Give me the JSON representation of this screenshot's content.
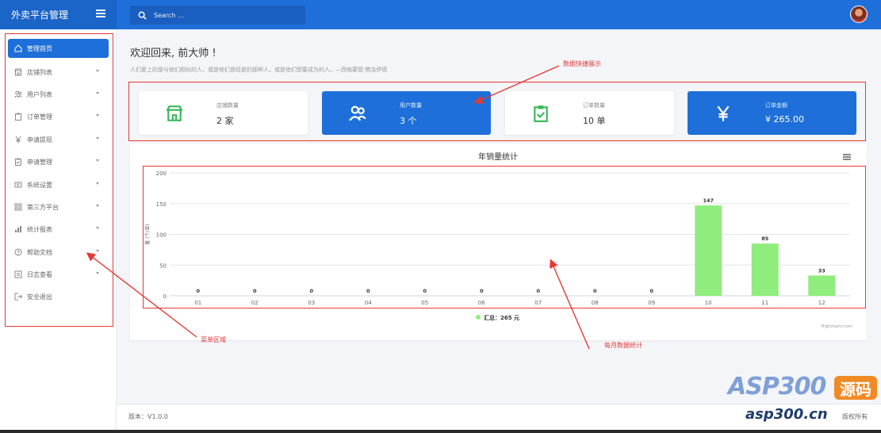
{
  "app": {
    "title": "外卖平台管理"
  },
  "search": {
    "placeholder": "Search ..."
  },
  "sidebar": {
    "items": [
      {
        "label": "管理首页",
        "icon": "home-icon",
        "active": true,
        "has_children": false
      },
      {
        "label": "店铺列表",
        "icon": "store-icon",
        "active": false,
        "has_children": true
      },
      {
        "label": "用户列表",
        "icon": "users-icon",
        "active": false,
        "has_children": true
      },
      {
        "label": "订单管理",
        "icon": "clipboard-icon",
        "active": false,
        "has_children": true
      },
      {
        "label": "申请提现",
        "icon": "yen-icon",
        "active": false,
        "has_children": true
      },
      {
        "label": "申请管理",
        "icon": "clipboard-check-icon",
        "active": false,
        "has_children": true
      },
      {
        "label": "系统设置",
        "icon": "settings-icon",
        "active": false,
        "has_children": true
      },
      {
        "label": "第三方平台",
        "icon": "grid-icon",
        "active": false,
        "has_children": true
      },
      {
        "label": "统计报表",
        "icon": "bar-chart-icon",
        "active": false,
        "has_children": true
      },
      {
        "label": "帮助文档",
        "icon": "help-icon",
        "active": false,
        "has_children": true
      },
      {
        "label": "日志查看",
        "icon": "log-icon",
        "active": false,
        "has_children": true
      },
      {
        "label": "安全退出",
        "icon": "logout-icon",
        "active": false,
        "has_children": false
      }
    ]
  },
  "main": {
    "welcome": "欢迎回来, 前大帅 !",
    "quote": "人们爱上的是与他们相似的人，或是他们曾经是的那种人，或是他们想要成为的人。—西格蒙德·佛洛伊德"
  },
  "cards": [
    {
      "label": "店铺数量",
      "value": "2 家",
      "icon": "store-icon",
      "style": "white"
    },
    {
      "label": "用户数量",
      "value": "3 个",
      "icon": "users-icon",
      "style": "blue"
    },
    {
      "label": "订单数量",
      "value": "10 单",
      "icon": "clipboard-check-icon",
      "style": "white"
    },
    {
      "label": "订单金额",
      "value": "¥ 265.00",
      "icon": "yen-icon",
      "style": "blue"
    }
  ],
  "chart_data": {
    "type": "bar",
    "title": "年销量统计",
    "ylabel": "量 (个/单)",
    "categories": [
      "01",
      "02",
      "03",
      "04",
      "05",
      "06",
      "07",
      "08",
      "09",
      "10",
      "11",
      "12"
    ],
    "series": [
      {
        "name": "汇总：265 元",
        "values": [
          0,
          0,
          0,
          0,
          0,
          0,
          0,
          0,
          0,
          147,
          85,
          33
        ],
        "color": "#90ed7d"
      }
    ],
    "ylim": [
      0,
      200
    ],
    "yticks": [
      0,
      50,
      100,
      150,
      200
    ],
    "grid": true,
    "legend": "bottom-center",
    "credit": "Highcharts.com"
  },
  "annotations": {
    "data_display": "数据快捷展示",
    "menu_area": "菜单区域",
    "monthly_stats": "每月数据统计"
  },
  "footer": {
    "version": "版本：V1.0.0",
    "rights": "版权所有"
  },
  "watermark": {
    "brand": "ASP300",
    "badge": "源码",
    "url": "asp300.cn"
  },
  "colors": {
    "primary": "#1e6fd9",
    "bar": "#90ed7d",
    "annotation": "#e53935"
  }
}
